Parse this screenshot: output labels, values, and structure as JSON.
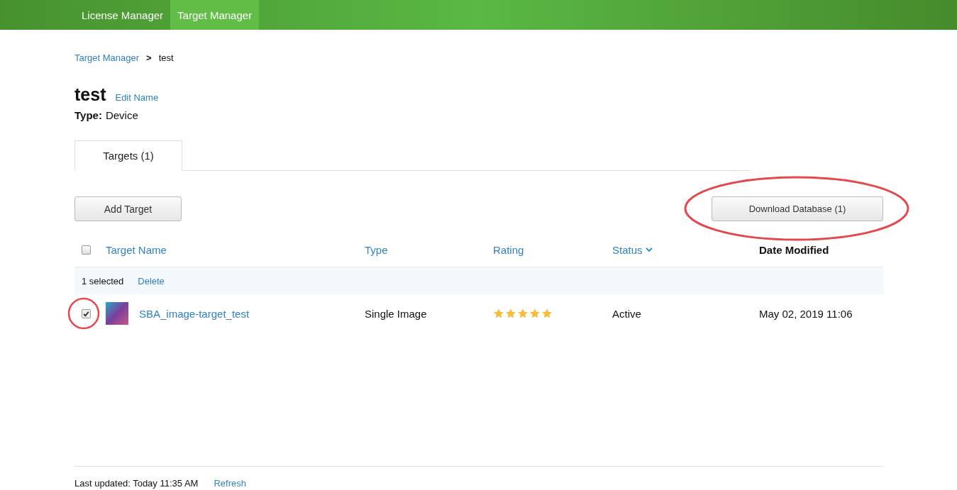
{
  "nav": [
    {
      "label": "License Manager",
      "selected": false
    },
    {
      "label": "Target Manager",
      "selected": true
    }
  ],
  "breadcrumb": {
    "link": "Target Manager",
    "separator": ">",
    "current": "test"
  },
  "title": "test",
  "edit_link": "Edit Name",
  "type_label": "Type:",
  "type_value": "Device",
  "tabs": [
    {
      "label": "Targets (1)",
      "selected": true
    }
  ],
  "add_button": {
    "label": "Add Target"
  },
  "download_button": {
    "label": "Download Database (1)",
    "highlighted": true
  },
  "table": {
    "select_all": {
      "checked": false
    },
    "columns": [
      {
        "label": "Target Name",
        "kind": "link",
        "sorted": false
      },
      {
        "label": "Type",
        "kind": "link",
        "sorted": false
      },
      {
        "label": "Rating",
        "kind": "link",
        "sorted": false
      },
      {
        "label": "Status",
        "kind": "link",
        "sorted": true
      },
      {
        "label": "Date Modified",
        "kind": "plain",
        "sorted": false
      }
    ],
    "selection_bar": {
      "count": "1 selected",
      "action": "Delete"
    },
    "rows": [
      {
        "checked": true,
        "highlighted": true,
        "name": "SBA_image-target_test",
        "type": "Single Image",
        "stars": 5,
        "status": "Active",
        "date": "May 02, 2019 11:06"
      }
    ]
  },
  "footer": {
    "updated": "Last updated: Today 11:35 AM",
    "refresh": "Refresh"
  }
}
